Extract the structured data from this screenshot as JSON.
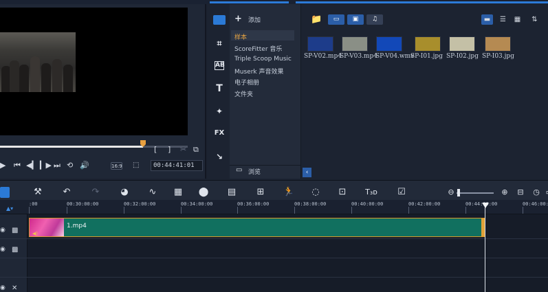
{
  "preview": {
    "timecode": "00:44:41:01",
    "aspect": "16:9",
    "controls": [
      "play",
      "prev-frame",
      "step-back",
      "step-forward",
      "next",
      "repeat",
      "volume"
    ]
  },
  "library": {
    "add_label": "添加",
    "browse_label": "浏览",
    "categories": [
      {
        "label": "样本",
        "selected": true
      },
      {
        "label": "ScoreFitter 音乐"
      },
      {
        "label": "Triple Scoop Music"
      },
      {
        "label": "Muserk 声音效果"
      },
      {
        "label": "电子相册"
      },
      {
        "label": "文件夹"
      }
    ],
    "media": [
      {
        "name": "SP-V02.mp4",
        "color": "#1d3c8a"
      },
      {
        "name": "SP-V03.mp4",
        "color": "#8a8f86"
      },
      {
        "name": "SP-V04.wmv",
        "color": "#1248b8"
      },
      {
        "name": "SP-I01.jpg",
        "color": "#a88e2c"
      },
      {
        "name": "SP-I02.jpg",
        "color": "#c4c0a6"
      },
      {
        "name": "SP-I03.jpg",
        "color": "#b58a52"
      }
    ],
    "rail_fx": "FX",
    "rail_ab": "AB",
    "rail_t": "T"
  },
  "timeline": {
    "ruler_labels": [
      "00:30:00:00",
      "00:32:00:00",
      "00:34:00:00",
      "00:36:00:00",
      "00:38:00:00",
      "00:40:00:00",
      "00:42:00:00",
      "00:44:00:00",
      "00:46:00:00"
    ],
    "first_tick": ":00",
    "clip_name": "1.mp4"
  }
}
